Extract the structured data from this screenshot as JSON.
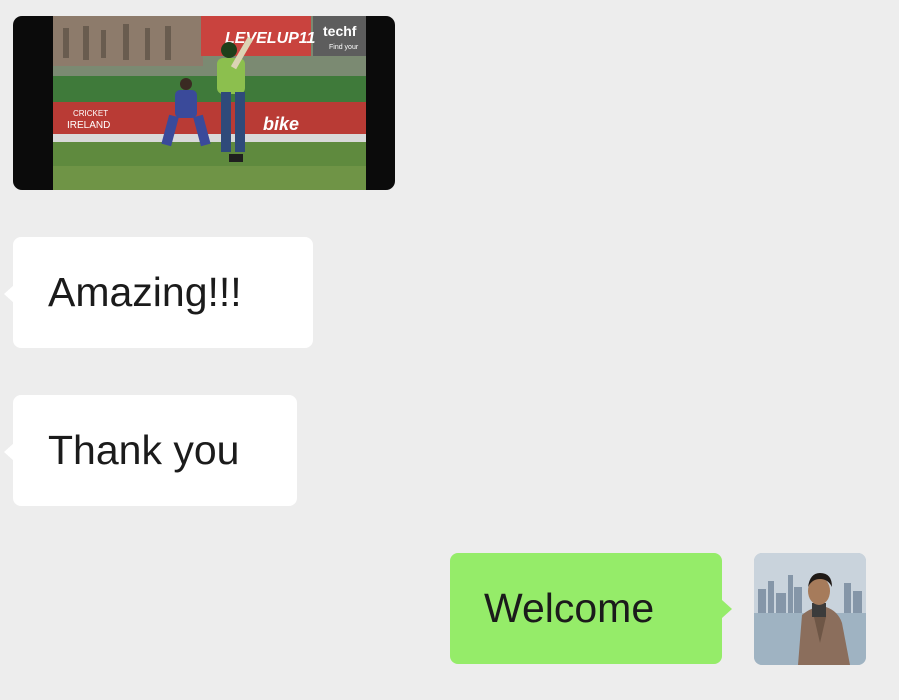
{
  "chat": {
    "video": {
      "icon": "play-video-icon",
      "scene": "cricket match clip",
      "overlay_text": {
        "scoreboard_brand": "techf",
        "scoreboard_tagline": "Find your",
        "banner_brand": "LEVELUP11",
        "sponsor": "bike",
        "board_top": "CRICKET",
        "board_bottom": "IRELAND"
      }
    },
    "messages": [
      {
        "direction": "incoming",
        "text": "Amazing!!!"
      },
      {
        "direction": "incoming",
        "text": "Thank you"
      },
      {
        "direction": "outgoing",
        "text": "Welcome"
      }
    ],
    "colors": {
      "background": "#ededed",
      "incoming_bubble": "#ffffff",
      "outgoing_bubble": "#95ec69",
      "text": "#1b1b1b"
    },
    "avatar": {
      "icon": "user-avatar-icon"
    }
  }
}
